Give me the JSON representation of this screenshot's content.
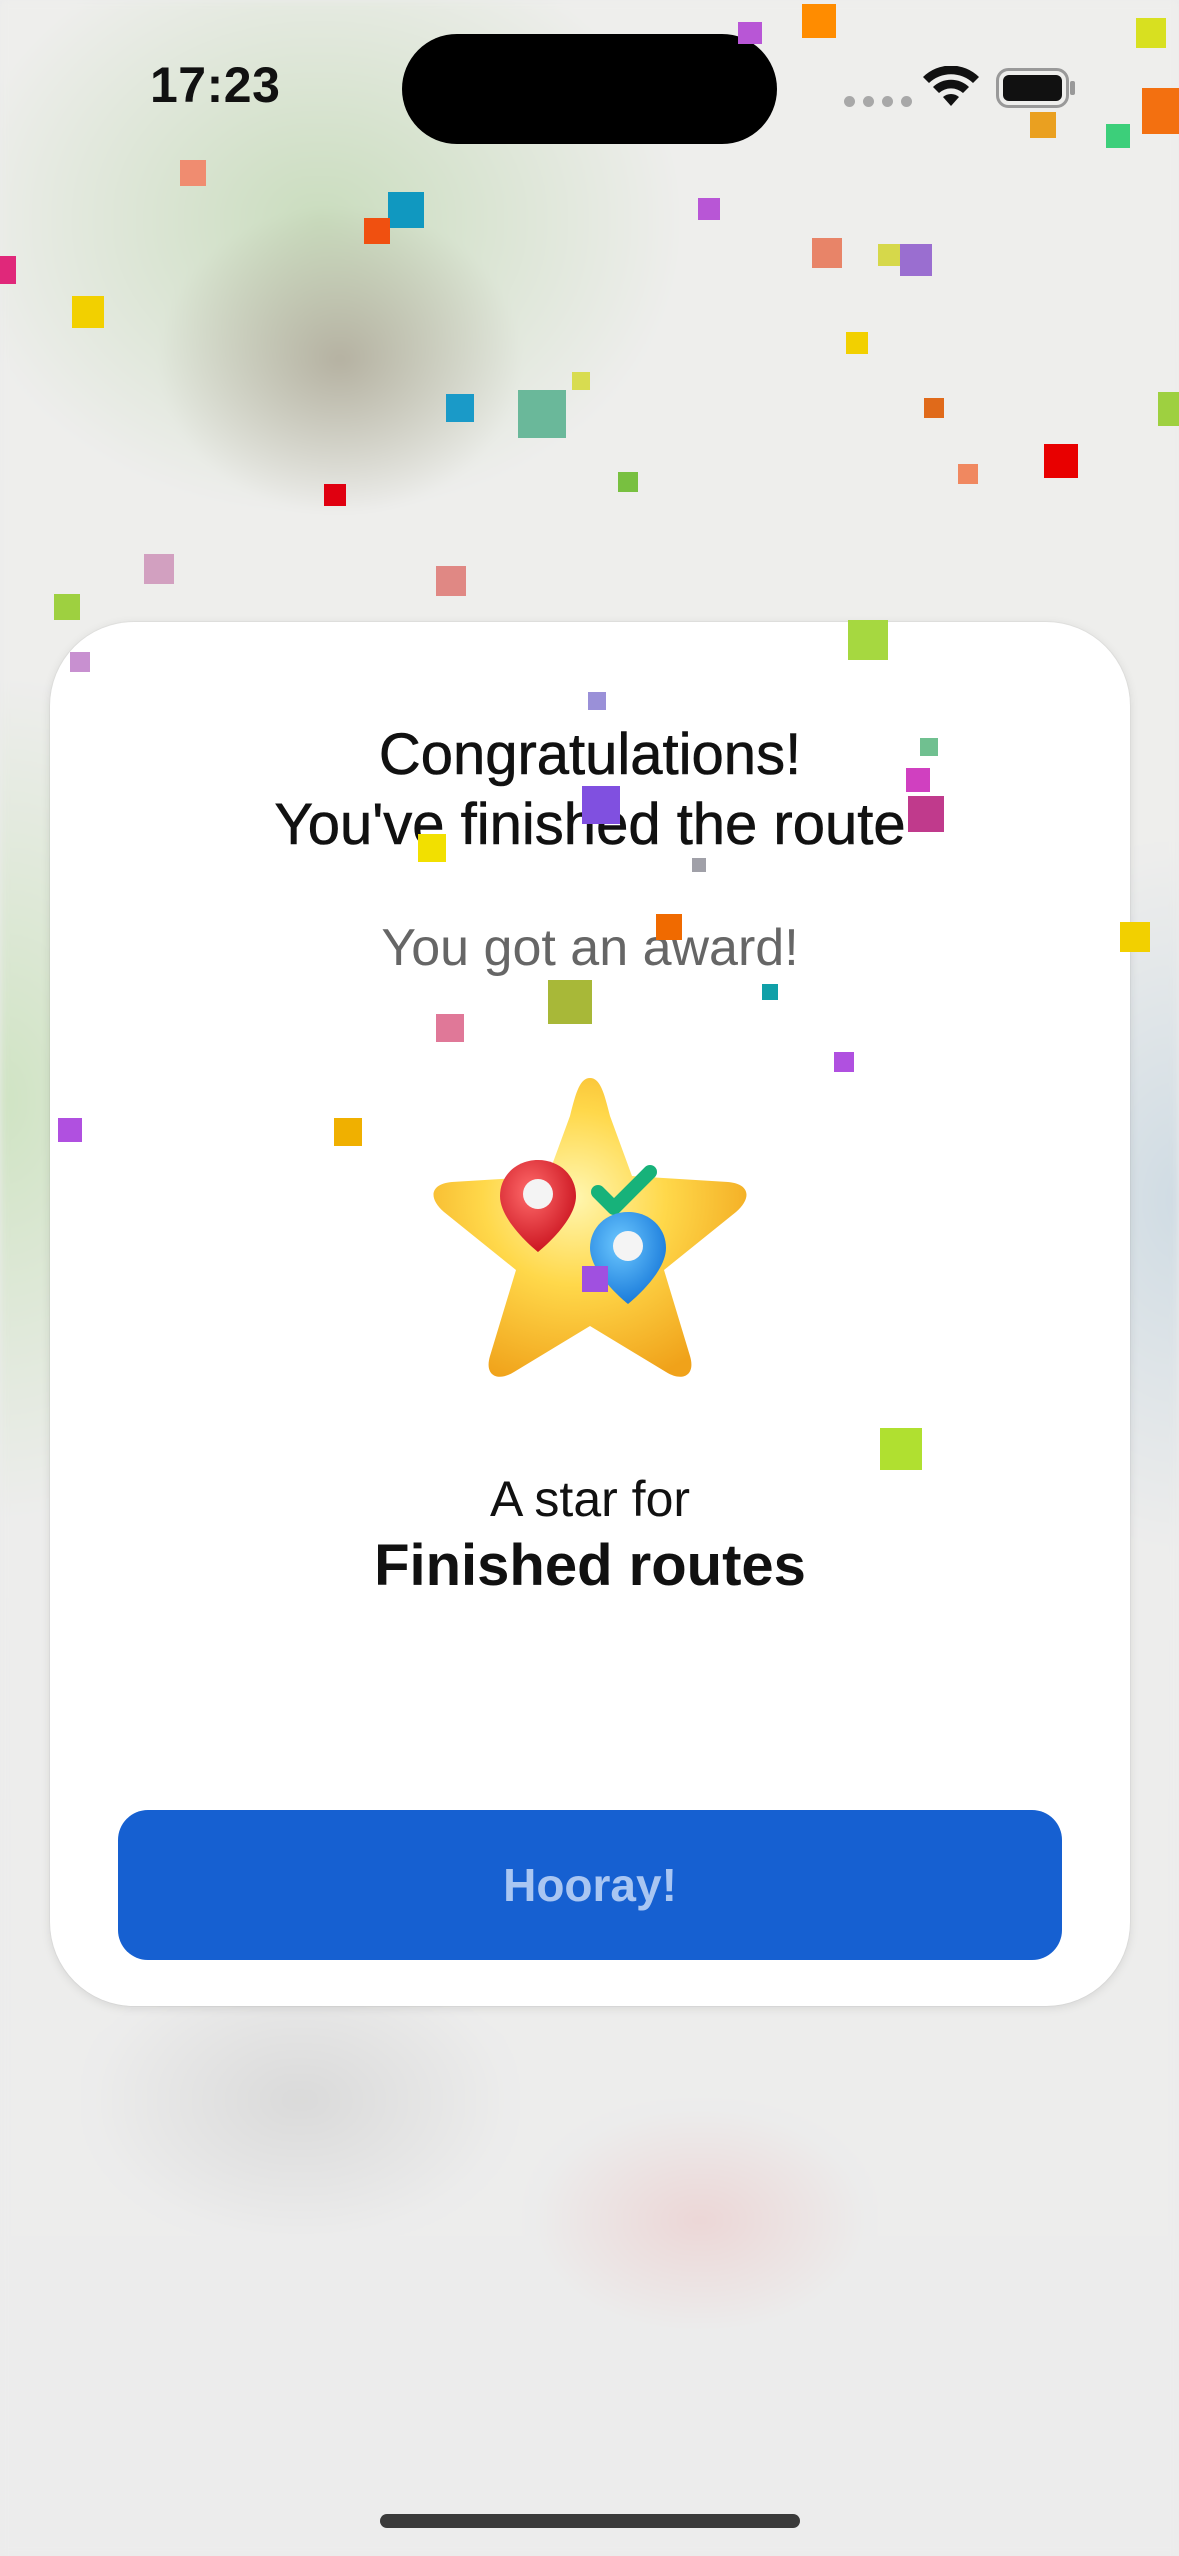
{
  "status_bar": {
    "time": "17:23",
    "icons": [
      "cellular-signal-icon",
      "wifi-icon",
      "battery-icon"
    ]
  },
  "modal": {
    "title_line1": "Congratulations!",
    "title_line2": "You've finished the route",
    "subtitle": "You got an award!",
    "award_icon": "star-with-map-pins-checkmark-icon",
    "award_prefix": "A star for",
    "award_name": "Finished routes",
    "button_label": "Hooray!"
  },
  "colors": {
    "accent": "#1660d1",
    "button_text": "#a9c6f2",
    "card_background": "#ffffff",
    "subtitle_text": "#666666"
  }
}
